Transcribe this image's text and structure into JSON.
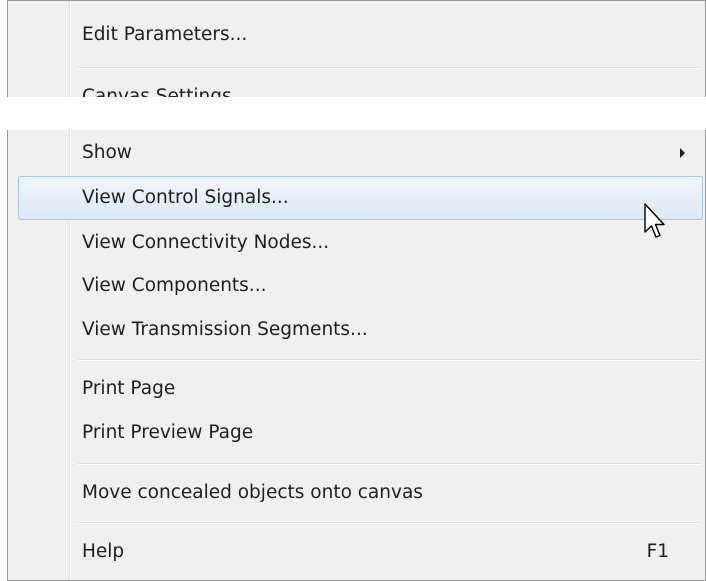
{
  "menu_top": {
    "items": [
      {
        "label": "Edit Parameters..."
      },
      {
        "label": "Canvas Settings..."
      }
    ]
  },
  "menu": {
    "items": [
      {
        "label": "Show",
        "submenu": true
      },
      {
        "label": "View Control Signals...",
        "highlighted": true
      },
      {
        "label": "View Connectivity Nodes..."
      },
      {
        "label": "View Components..."
      },
      {
        "label": "View Transmission Segments..."
      },
      {
        "label": "Print Page"
      },
      {
        "label": "Print Preview Page"
      },
      {
        "label": "Move concealed objects onto canvas"
      },
      {
        "label": "Help",
        "shortcut": "F1"
      }
    ]
  },
  "icons": {
    "submenu_arrow": "chevron-right-icon",
    "cursor": "mouse-pointer-icon"
  },
  "colors": {
    "menu_bg": "#f0f0f0",
    "highlight_border": "#a8cae9",
    "highlight_bg": "#dde9f6"
  }
}
